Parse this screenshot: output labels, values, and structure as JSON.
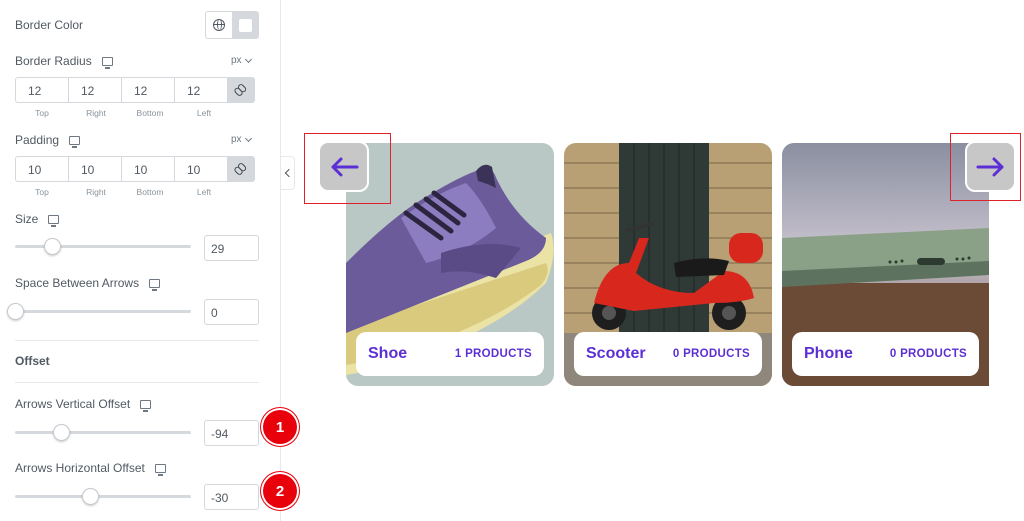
{
  "panel": {
    "border_color_label": "Border Color",
    "border_radius": {
      "label": "Border Radius",
      "units": "px",
      "values": [
        "12",
        "12",
        "12",
        "12"
      ],
      "sides": [
        "Top",
        "Right",
        "Bottom",
        "Left"
      ]
    },
    "padding": {
      "label": "Padding",
      "units": "px",
      "values": [
        "10",
        "10",
        "10",
        "10"
      ],
      "sides": [
        "Top",
        "Right",
        "Bottom",
        "Left"
      ]
    },
    "size": {
      "label": "Size",
      "value": "29"
    },
    "space_between": {
      "label": "Space Between Arrows",
      "value": "0"
    },
    "offset_title": "Offset",
    "vertical_offset": {
      "label": "Arrows Vertical Offset",
      "value": "-94"
    },
    "horizontal_offset": {
      "label": "Arrows Horizontal Offset",
      "value": "-30"
    }
  },
  "badges": [
    "1",
    "2"
  ],
  "cards": [
    {
      "name": "Shoe",
      "count": "1 PRODUCTS"
    },
    {
      "name": "Scooter",
      "count": "0 PRODUCTS"
    },
    {
      "name": "Phone",
      "count": "0 PRODUCTS"
    }
  ],
  "colors": {
    "accent": "#5b2fd4",
    "arrow_bg": "#c7c7c7",
    "highlight": "#e0202a",
    "badge": "#e8000b"
  },
  "icons": {
    "prev_arrow": "arrow-left-icon",
    "next_arrow": "arrow-right-icon",
    "device": "desktop-icon",
    "globe": "globe-icon",
    "link": "link-icon"
  }
}
